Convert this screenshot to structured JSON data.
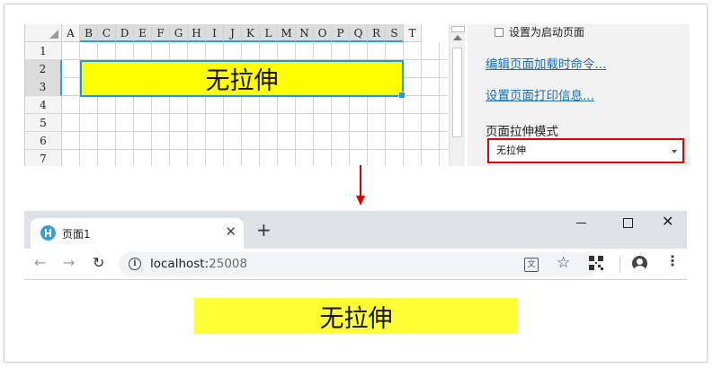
{
  "designer": {
    "columns": [
      "A",
      "B",
      "C",
      "D",
      "E",
      "F",
      "G",
      "H",
      "I",
      "J",
      "K",
      "L",
      "M",
      "N",
      "O",
      "P",
      "Q",
      "R",
      "S",
      "T"
    ],
    "rows": [
      "1",
      "2",
      "3",
      "4",
      "5",
      "6",
      "7"
    ],
    "merged_cell_text": "无拉伸",
    "colors": {
      "cell_fill": "#ffff00",
      "selection": "#1f9ad6"
    }
  },
  "properties": {
    "startup_checkbox_label": "设置为启动页面",
    "edit_load_command_link": "编辑页面加载时命令...",
    "print_info_link": "设置页面打印信息...",
    "stretch_mode_label": "页面拉伸模式",
    "stretch_mode_value": "无拉伸",
    "highlight_color": "#e00000"
  },
  "browser": {
    "tab_title": "页面1",
    "tab_close": "✕",
    "new_tab": "+",
    "win_close": "✕",
    "url_host": "localhost:",
    "url_port": "25008",
    "back": "←",
    "forward": "→",
    "reload": "↻",
    "star": "☆",
    "menu": "⋮",
    "info": "i",
    "translate": "文",
    "page_text": "无拉伸",
    "page_fill": "#ffff33"
  }
}
